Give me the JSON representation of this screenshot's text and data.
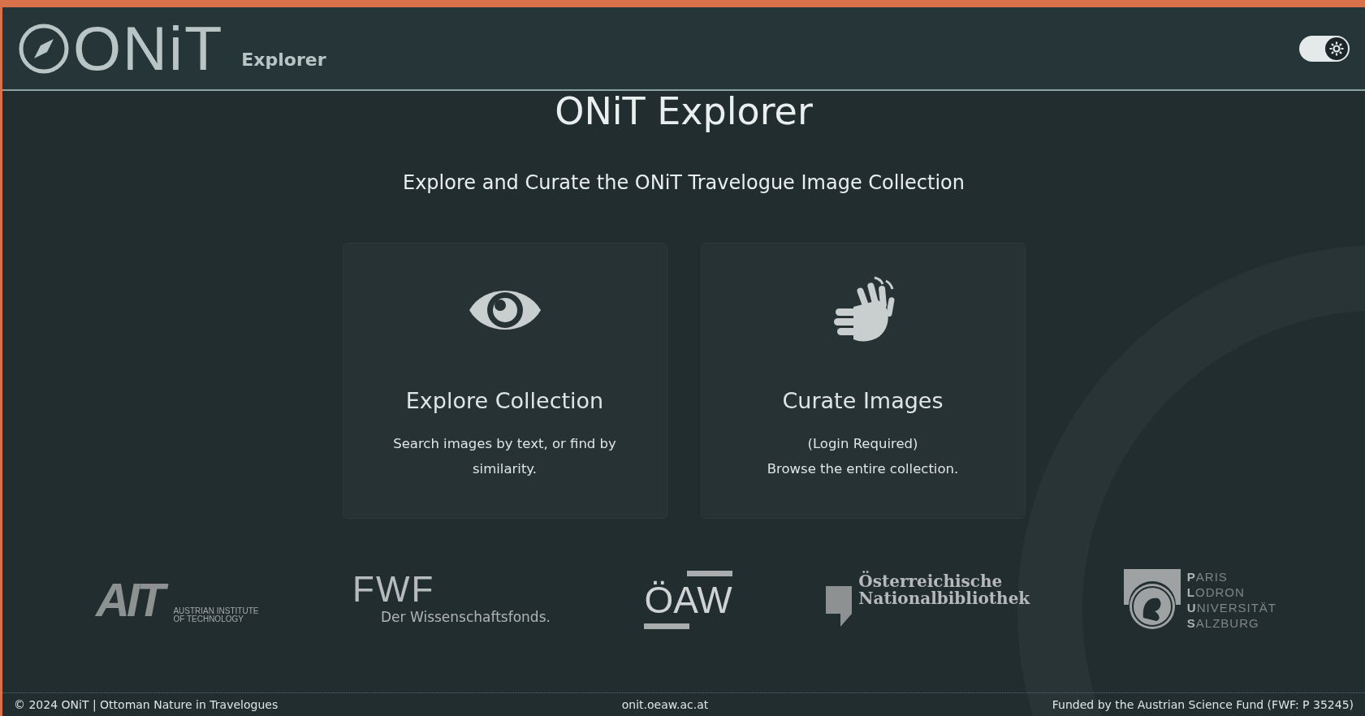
{
  "header": {
    "logo_text": "ONiT",
    "subtitle": "Explorer",
    "theme_switch": {
      "on": true
    }
  },
  "title": "ONiT Explorer",
  "tagline": "Explore and Curate the ONiT Travelogue Image Collection",
  "cards": [
    {
      "kind": "eye",
      "title": "Explore Collection",
      "lines": [
        "Search images by text, or find by similarity."
      ]
    },
    {
      "kind": "hands",
      "title": "Curate Images",
      "lines": [
        "(Login Required)",
        "Browse the entire collection."
      ]
    }
  ],
  "partners": [
    {
      "kind": "ait",
      "mark": "AIT",
      "lines": [
        "AUSTRIAN INSTITUTE",
        "OF TECHNOLOGY"
      ]
    },
    {
      "kind": "fwf",
      "mark": "FWF",
      "lines": [
        "Der Wissenschaftsfonds."
      ]
    },
    {
      "kind": "oeaw",
      "mark": "ÖAW"
    },
    {
      "kind": "onb",
      "lines": [
        "Österreichische",
        "Nationalbibliothek"
      ]
    },
    {
      "kind": "plus",
      "lines": [
        "**P**ARIS",
        "**L**ODRON",
        "**U**NIVERSITÄT",
        "**S**ALZBURG"
      ]
    }
  ],
  "footer": {
    "left": "© 2024 ONiT | Ottoman Nature in Travelogues",
    "center": "onit.oeaw.ac.at",
    "right": "Funded by the Austrian Science Fund (FWF: P 35245)"
  }
}
